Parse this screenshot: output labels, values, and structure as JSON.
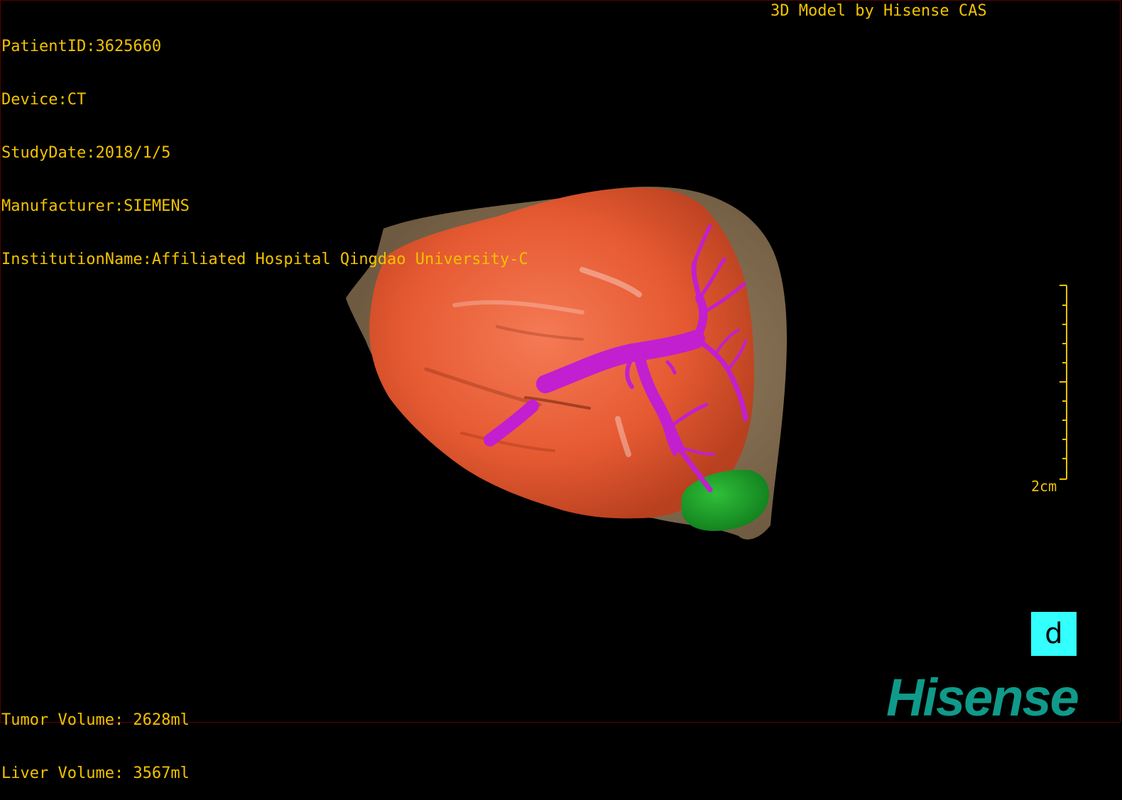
{
  "patient": {
    "id_line": "PatientID:3625660",
    "device_line": "Device:CT",
    "study_date_line": "StudyDate:2018/1/5",
    "manufacturer_line": "Manufacturer:SIEMENS",
    "institution_line": "InstitutionName:Affiliated Hospital Qingdao University-C"
  },
  "model_credit": "3D Model by Hisense CAS",
  "volumes": {
    "tumor_line": "Tumor Volume: 2628ml",
    "liver_line": "Liver Volume: 3567ml"
  },
  "scale_bar": {
    "label": "2cm"
  },
  "view_button": {
    "label": "d"
  },
  "brand_logo": "Hisense",
  "colors": {
    "overlay_text": "#f2c200",
    "liver": "#f05a35",
    "liver_background": "#8b7355",
    "vessel": "#c21fd0",
    "tumor": "#1a9c2a",
    "view_button": "#33ffff",
    "logo": "#0f9a8a"
  },
  "icons": {
    "view_button_glyph": "view-orientation-icon"
  }
}
